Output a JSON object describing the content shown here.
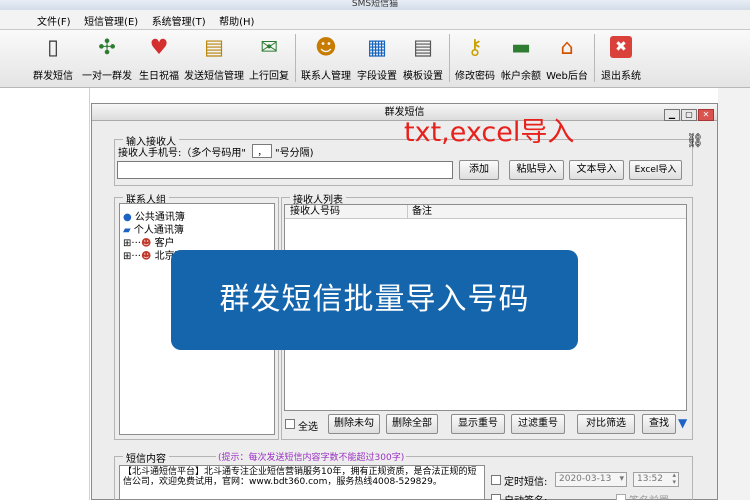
{
  "app": {
    "title": "SMS短信猫"
  },
  "menu": [
    "文件(F)",
    "短信管理(E)",
    "系统管理(T)",
    "帮助(H)"
  ],
  "toolbar": [
    {
      "label": "群发短信",
      "icon": "phone-icon",
      "glyph": "📱"
    },
    {
      "label": "一对一群发",
      "icon": "people-network-icon",
      "glyph": "✖"
    },
    {
      "label": "生日祝福",
      "icon": "heart-icon",
      "glyph": "❤"
    },
    {
      "label": "发送短信管理",
      "icon": "calendar-icon",
      "glyph": "📅"
    },
    {
      "label": "上行回复",
      "icon": "envelope-check-icon",
      "glyph": "✉"
    },
    {
      "label": "联系人管理",
      "icon": "contacts-icon",
      "glyph": "👥"
    },
    {
      "label": "字段设置",
      "icon": "grid-icon",
      "glyph": "▦"
    },
    {
      "label": "模板设置",
      "icon": "template-icon",
      "glyph": "📄"
    },
    {
      "label": "修改密码",
      "icon": "key-icon",
      "glyph": "🔑"
    },
    {
      "label": "帐户余额",
      "icon": "account-balance-icon",
      "glyph": "💳"
    },
    {
      "label": "Web后台",
      "icon": "home-icon",
      "glyph": "🏠"
    },
    {
      "label": "退出系统",
      "icon": "exit-icon",
      "glyph": "✖"
    }
  ],
  "dialog": {
    "title": "群发短信",
    "input_group": {
      "title": "输入接收人",
      "phone_label": "接收人手机号:（多个号码用\"",
      "separator_value": "，",
      "phone_label_suffix": "\"号分隔)",
      "phone_value": "",
      "buttons": [
        "添加",
        "粘贴导入",
        "文本导入",
        "Excel导入"
      ]
    },
    "contacts_group": {
      "title": "联系人组",
      "tree": [
        {
          "label": "公共通讯簿",
          "icon": "globe-icon"
        },
        {
          "label": "个人通讯簿",
          "icon": "book-icon"
        },
        {
          "label": "客户",
          "icon": "contacts-icon"
        },
        {
          "label": "北京客户",
          "icon": "contacts-icon"
        }
      ]
    },
    "recipients_group": {
      "title": "接收人列表",
      "columns": [
        "接收人号码",
        "备注"
      ]
    },
    "actions": {
      "select_all_label": "全选",
      "buttons": [
        "删除未勾",
        "删除全部",
        "显示重号",
        "过滤重号",
        "对比筛选",
        "查找"
      ]
    },
    "content_group": {
      "title": "短信内容",
      "hint": "(提示：每次发送短信内容字数不能超过300字)",
      "text": "【北斗通短信平台】北斗通专注企业短信营销服务10年，拥有正规资质，是合法正规的短信公司，欢迎免费试用，官网：www.bdt360.com，服务热线4008-529829。",
      "scheduled_label": "定时短信:",
      "date_value": "2020-03-13",
      "time_value": "13:52",
      "auto_sign_label": "自动签名:",
      "sign_option_label": "签名前置"
    }
  },
  "annotations": {
    "top_text": "txt,excel导入",
    "banner_text": "群发短信批量导入号码"
  },
  "colors": {
    "banner": "#1565ac",
    "annotation": "#e8211c",
    "hint": "#9b30c4"
  }
}
